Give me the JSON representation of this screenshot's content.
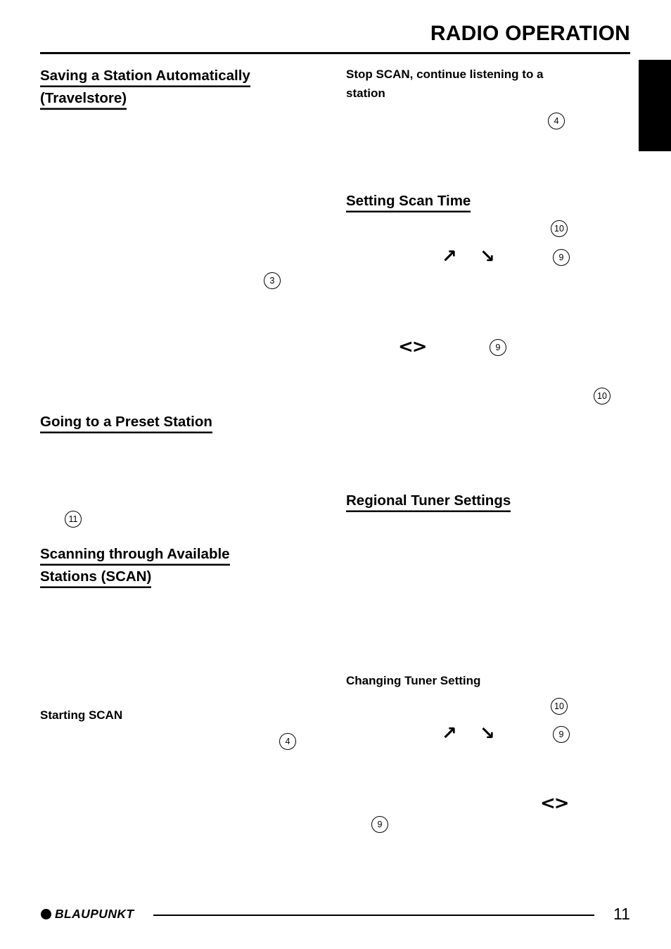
{
  "header": {
    "title": "RADIO OPERATION"
  },
  "left_column": {
    "heading_travelstore": {
      "line1": "Saving a Station Automatically",
      "line2": "(Travelstore)"
    },
    "callout_3": "3",
    "heading_preset": "Going to a Preset Station",
    "callout_11": "11",
    "heading_scan": {
      "line1": "Scanning through Available",
      "line2": "Stations (SCAN)"
    },
    "subheading_starting_scan": "Starting SCAN",
    "callout_4": "4"
  },
  "right_column": {
    "subheading_stop_scan": {
      "line1": "Stop SCAN, continue listening to a",
      "line2": "station"
    },
    "callout_4": "4",
    "heading_scan_time": "Setting Scan Time",
    "callout_10_a": "10",
    "callout_9_a": "9",
    "arrow_up": "↗",
    "arrow_down": "↘",
    "callout_9_b": "9",
    "lr_glyph": "<>",
    "callout_10_b": "10",
    "heading_regional": "Regional Tuner Settings",
    "subheading_changing_tuner": "Changing Tuner Setting",
    "callout_10_c": "10",
    "callout_9_c": "9",
    "arrow_up_2": "↗",
    "arrow_down_2": "↘",
    "lr_glyph_2": "<>",
    "callout_9_d": "9"
  },
  "footer": {
    "brand": "BLAUPUNKT",
    "page_number": "11"
  }
}
